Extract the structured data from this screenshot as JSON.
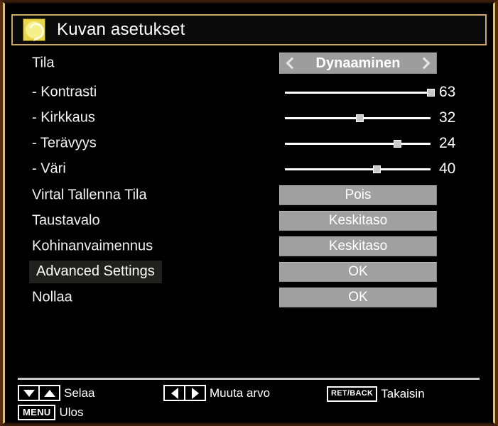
{
  "window": {
    "title": "Kuvan asetukset",
    "icon": "picture-settings-icon",
    "frame_color": "#d9c07a",
    "title_border_color": "#c9a86a",
    "background": "#000000"
  },
  "menu": {
    "rows": [
      {
        "type": "selector",
        "label": "Tila",
        "value": "Dynaaminen",
        "left_icon": "chevron-left-icon",
        "right_icon": "chevron-right-icon",
        "name": "mode"
      },
      {
        "type": "slider",
        "label": "- Kontrasti",
        "value": 63,
        "min": 0,
        "max": 63,
        "percent": 100,
        "name": "contrast"
      },
      {
        "type": "slider",
        "label": "- Kirkkaus",
        "value": 32,
        "min": 0,
        "max": 63,
        "percent": 51,
        "name": "brightness"
      },
      {
        "type": "slider",
        "label": "- Terävyys",
        "value": 24,
        "min": 0,
        "max": 31,
        "percent": 77,
        "name": "sharpness"
      },
      {
        "type": "slider",
        "label": "- Väri",
        "value": 40,
        "min": 0,
        "max": 63,
        "percent": 63,
        "name": "color"
      },
      {
        "type": "button",
        "label": "Virtal Tallenna Tila",
        "value": "Pois",
        "name": "power-save-mode"
      },
      {
        "type": "button",
        "label": "Taustavalo",
        "value": "Keskitaso",
        "name": "backlight"
      },
      {
        "type": "button",
        "label": "Kohinanvaimennus",
        "value": "Keskitaso",
        "name": "noise-reduction"
      },
      {
        "type": "button",
        "label": "Advanced Settings",
        "value": "OK",
        "selected": true,
        "name": "advanced-settings"
      },
      {
        "type": "button",
        "label": "Nollaa",
        "value": "OK",
        "name": "reset"
      }
    ]
  },
  "footer": {
    "hints": [
      {
        "keys": [
          "arrow-down-icon",
          "arrow-up-icon"
        ],
        "label": "Selaa",
        "name": "navigate"
      },
      {
        "keys": [
          "arrow-left-icon",
          "arrow-right-icon"
        ],
        "label": "Muuta arvo",
        "name": "change-value"
      },
      {
        "keys": [
          "RET/BACK"
        ],
        "label": "Takaisin",
        "name": "back"
      },
      {
        "keys": [
          "MENU"
        ],
        "label": "Ulos",
        "name": "exit"
      }
    ]
  }
}
